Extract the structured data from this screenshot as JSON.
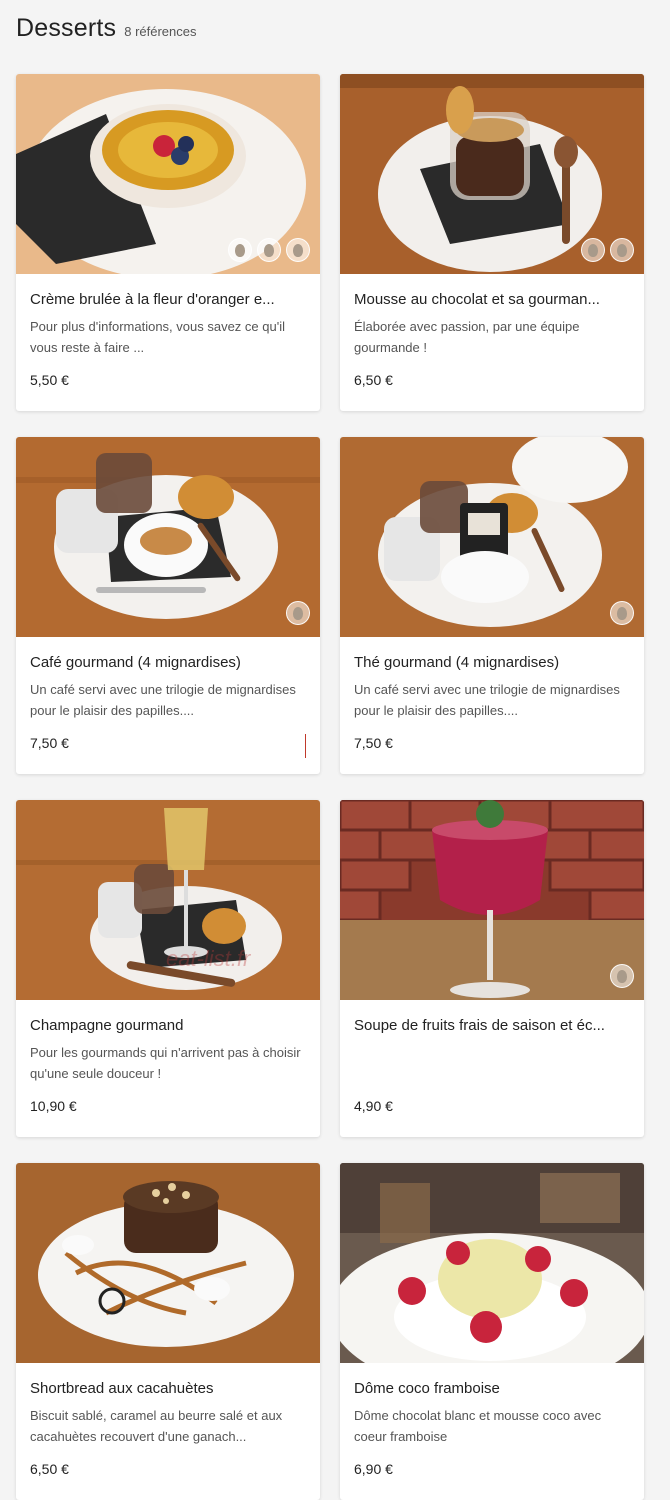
{
  "header": {
    "title": "Desserts",
    "count": "8 références"
  },
  "watermark": "eat-list.fr",
  "items": [
    {
      "name": "Crème brulée à la fleur d'oranger e...",
      "description": "Pour plus d'informations, vous savez ce qu'il vous reste à faire ...",
      "price": "5,50 €"
    },
    {
      "name": "Mousse au chocolat et sa gourman...",
      "description": "Élaborée avec passion, par une équipe gourmande !",
      "price": "6,50 €"
    },
    {
      "name": "Café gourmand (4 mignardises)",
      "description": "Un café servi avec une trilogie de mignardises pour le plaisir des papilles....",
      "price": "7,50 €"
    },
    {
      "name": "Thé gourmand (4 mignardises)",
      "description": "Un café servi avec une trilogie de mignardises pour le plaisir des papilles....",
      "price": "7,50 €"
    },
    {
      "name": "Champagne gourmand",
      "description": "Pour les gourmands qui n'arrivent pas à choisir qu'une seule douceur !",
      "price": "10,90 €"
    },
    {
      "name": "Soupe de fruits frais de saison et éc...",
      "description": "",
      "price": "4,90 €"
    },
    {
      "name": "Shortbread aux cacahuètes",
      "description": "Biscuit sablé, caramel au beurre salé et aux cacahuètes recouvert d'une ganach...",
      "price": "6,50 €"
    },
    {
      "name": "Dôme coco framboise",
      "description": "Dôme chocolat blanc et mousse coco avec coeur framboise",
      "price": "6,90 €"
    }
  ],
  "colors": {
    "background": "#f4f4f4",
    "card": "#ffffff",
    "wood": "#b8733a",
    "accent_red": "#c0392b"
  },
  "icons": [
    "allergen-badge-icon"
  ]
}
